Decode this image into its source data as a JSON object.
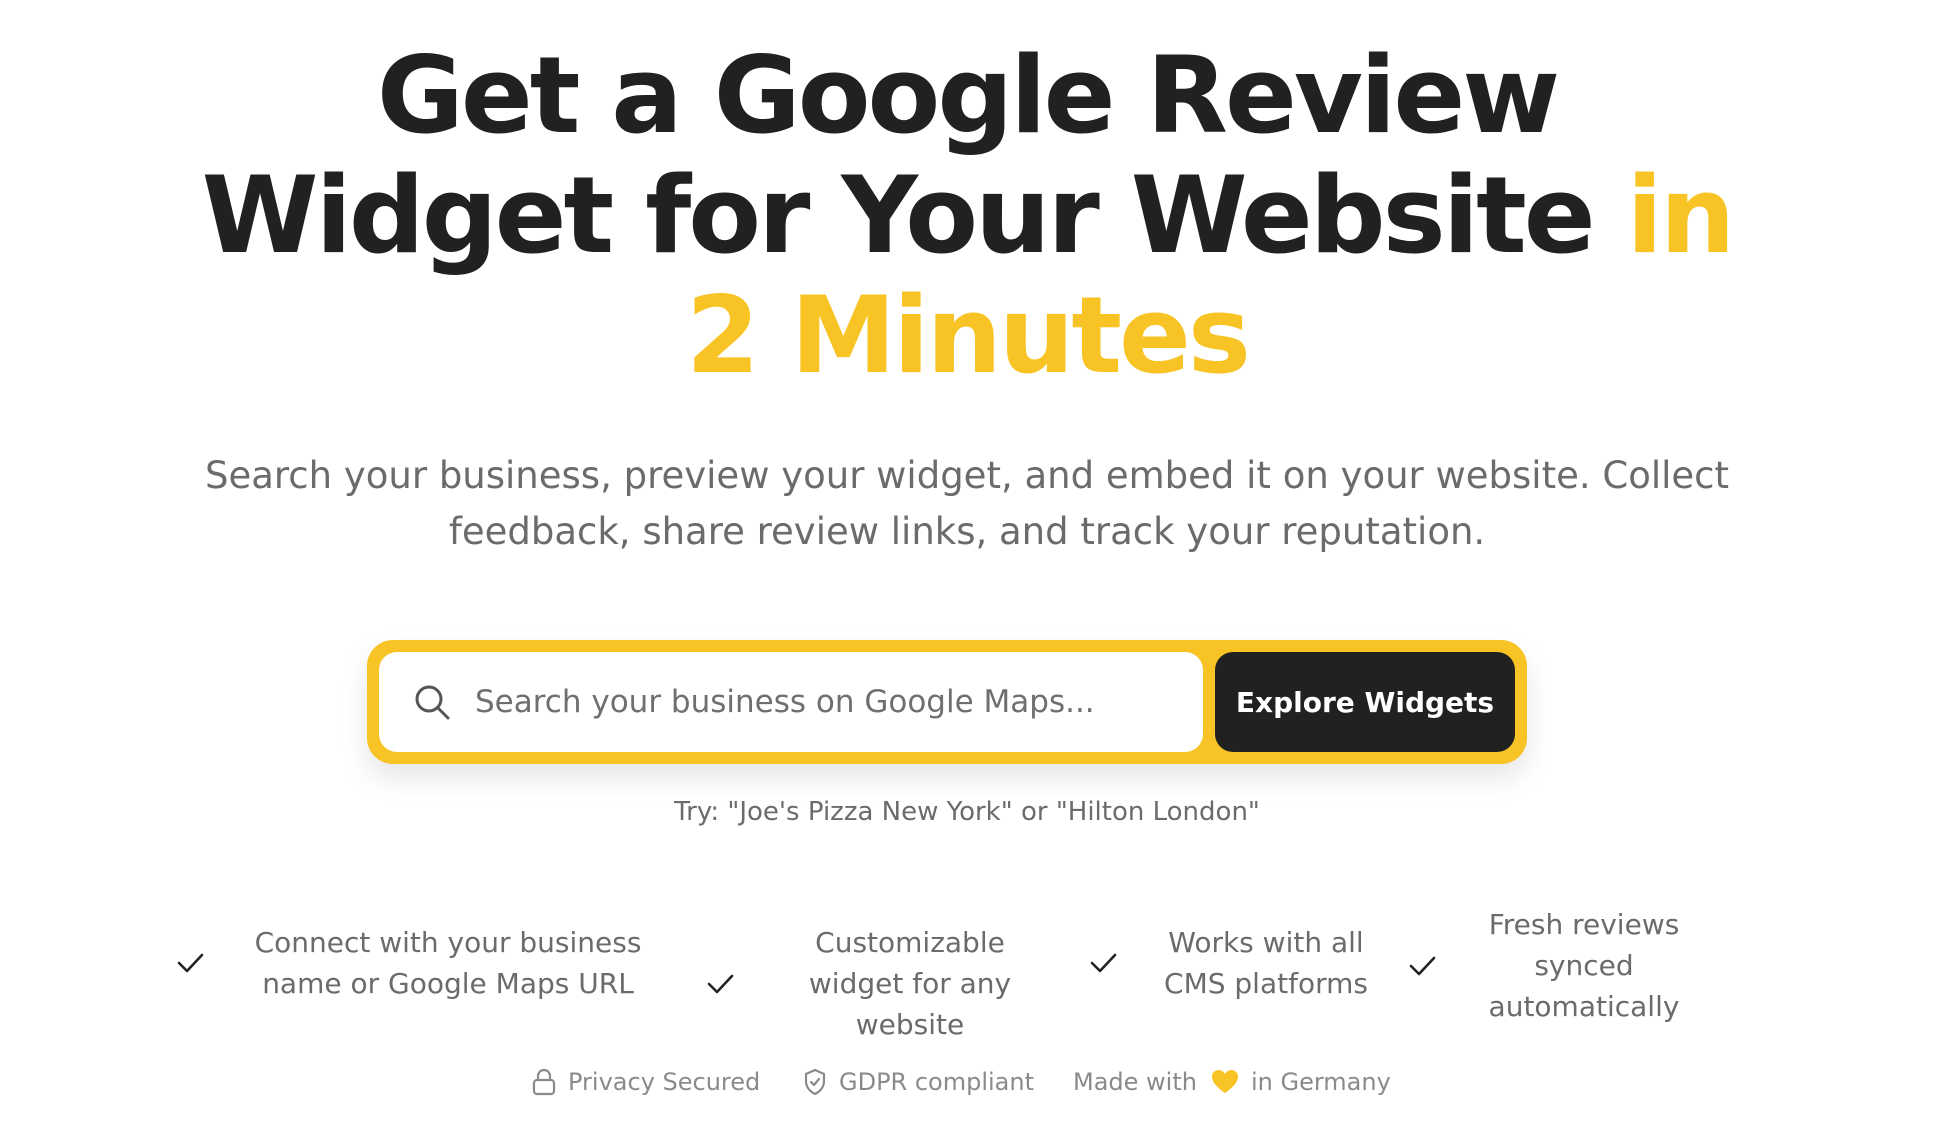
{
  "hero": {
    "title_line1": "Get a Google Review",
    "title_line2_main": "Widget for Your Website ",
    "title_line2_accent": "in",
    "title_line3_accent": "2 Minutes",
    "subtitle": "Search your business, preview your widget, and embed it on your website. Collect feedback, share review links, and track your reputation."
  },
  "search": {
    "placeholder": "Search your business on Google Maps...",
    "button_label": "Explore Widgets",
    "examples": "Try: \"Joe's Pizza New York\" or \"Hilton London\""
  },
  "features": [
    {
      "icon": "check-icon",
      "text": "Connect with your business name or Google Maps URL"
    },
    {
      "icon": "check-icon",
      "text": "Customizable widget for any website"
    },
    {
      "icon": "check-icon",
      "text": "Works with all CMS platforms"
    },
    {
      "icon": "check-icon",
      "text": "Fresh reviews synced automatically"
    }
  ],
  "trust": {
    "privacy": {
      "icon": "lock-icon",
      "label": "Privacy Secured"
    },
    "gdpr": {
      "icon": "shield-check-icon",
      "label": "GDPR compliant"
    },
    "made": {
      "prefix": "Made with",
      "icon": "heart-icon",
      "suffix": "in Germany"
    }
  },
  "colors": {
    "accent": "#F8C325",
    "dark": "#212121",
    "muted": "#6b6b6b"
  }
}
